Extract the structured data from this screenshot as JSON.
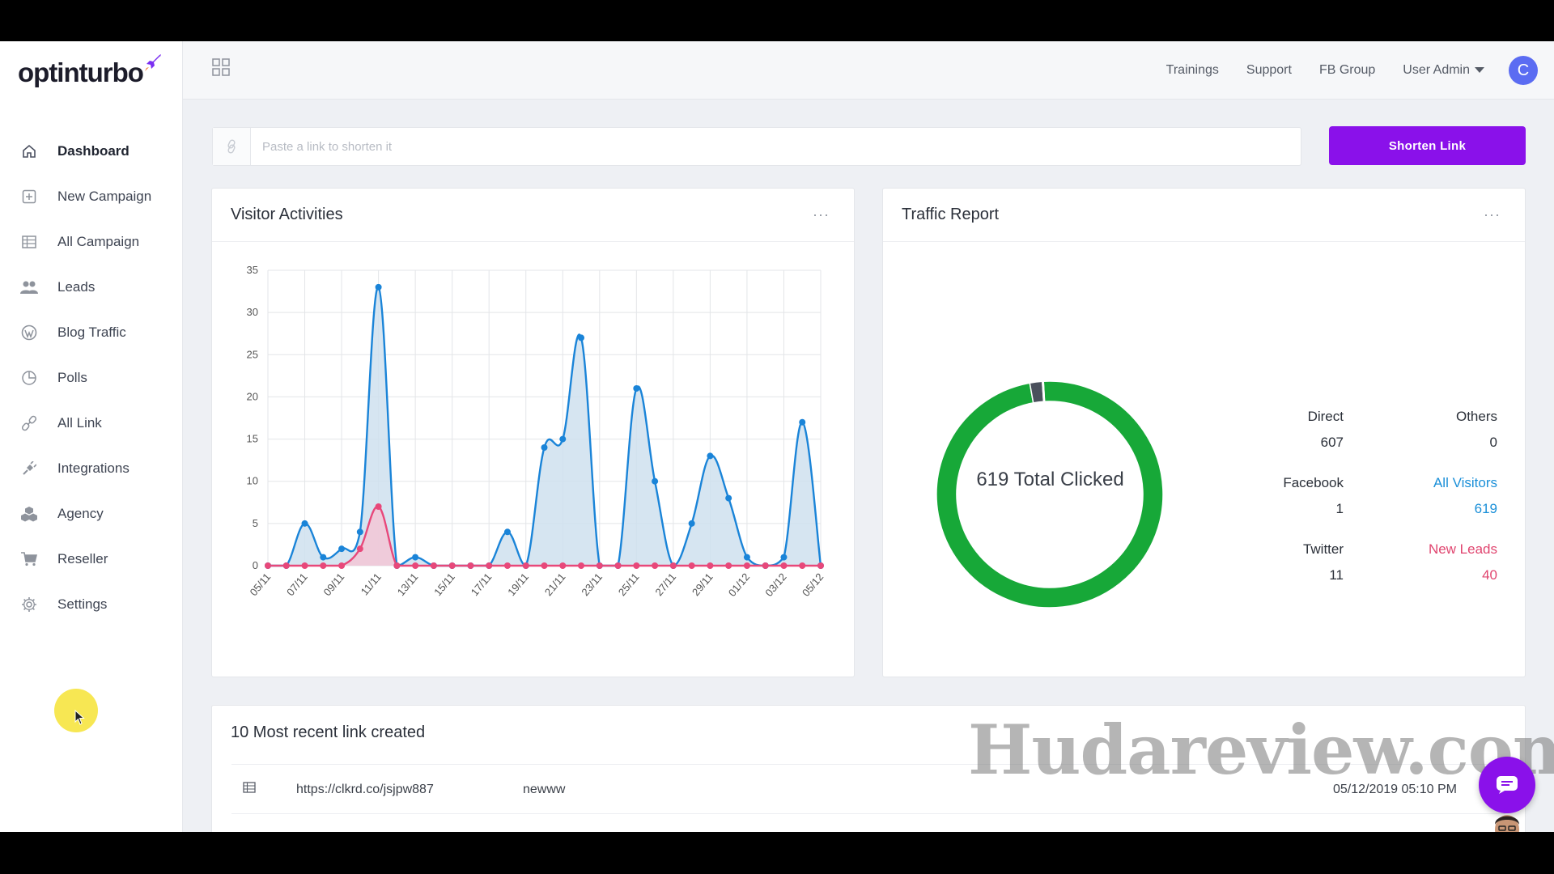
{
  "app": {
    "logo_text": "optinturbo"
  },
  "sidebar": {
    "items": [
      {
        "label": "Dashboard",
        "icon": "home-icon",
        "active": true
      },
      {
        "label": "New Campaign",
        "icon": "plus-square-icon"
      },
      {
        "label": "All Campaign",
        "icon": "table-icon"
      },
      {
        "label": "Leads",
        "icon": "users-icon"
      },
      {
        "label": "Blog Traffic",
        "icon": "wordpress-icon"
      },
      {
        "label": "Polls",
        "icon": "pie-icon"
      },
      {
        "label": "All Link",
        "icon": "link-icon"
      },
      {
        "label": "Integrations",
        "icon": "plug-icon"
      },
      {
        "label": "Agency",
        "icon": "cubes-icon"
      },
      {
        "label": "Reseller",
        "icon": "cart-icon"
      },
      {
        "label": "Settings",
        "icon": "gear-icon"
      }
    ]
  },
  "header": {
    "links": [
      "Trainings",
      "Support",
      "FB Group"
    ],
    "user_menu": "User Admin",
    "avatar_letter": "C"
  },
  "shorten": {
    "placeholder": "Paste a link to shorten it",
    "button_label": "Shorten Link"
  },
  "visitor_card": {
    "title": "Visitor Activities",
    "menu": "···"
  },
  "traffic_card": {
    "title": "Traffic Report",
    "menu": "···",
    "center_label": "619 Total Clicked",
    "stats": {
      "direct_label": "Direct",
      "direct_value": "607",
      "others_label": "Others",
      "others_value": "0",
      "facebook_label": "Facebook",
      "facebook_value": "1",
      "all_visitors_label": "All Visitors",
      "all_visitors_value": "619",
      "twitter_label": "Twitter",
      "twitter_value": "11",
      "new_leads_label": "New Leads",
      "new_leads_value": "40"
    }
  },
  "recent_card": {
    "title": "10 Most recent link created",
    "rows": [
      {
        "url": "https://clkrd.co/jsjpw887",
        "name": "newww",
        "date": "05/12/2019 05:10 PM"
      }
    ]
  },
  "watermark": "Hudareview.com",
  "chart_data": [
    {
      "type": "area",
      "title": "",
      "xlabel": "",
      "ylabel": "",
      "ylim": [
        0,
        35
      ],
      "yticks": [
        0,
        5,
        10,
        15,
        20,
        25,
        30,
        35
      ],
      "grid": true,
      "x": [
        "05/11",
        "06/11",
        "07/11",
        "08/11",
        "09/11",
        "10/11",
        "11/11",
        "12/11",
        "13/11",
        "14/11",
        "15/11",
        "16/11",
        "17/11",
        "18/11",
        "19/11",
        "20/11",
        "21/11",
        "22/11",
        "23/11",
        "24/11",
        "25/11",
        "26/11",
        "27/11",
        "28/11",
        "29/11",
        "30/11",
        "01/12",
        "02/12",
        "03/12",
        "04/12",
        "05/12"
      ],
      "x_tick_labels": [
        "05/11",
        "07/11",
        "09/11",
        "11/11",
        "13/11",
        "15/11",
        "17/11",
        "19/11",
        "21/11",
        "23/11",
        "25/11",
        "27/11",
        "29/11",
        "01/12",
        "03/12",
        "05/12"
      ],
      "series": [
        {
          "name": "",
          "color": "#1a84d8",
          "fill": "#cfe0ee",
          "values": [
            0,
            0,
            5,
            1,
            2,
            4,
            33,
            0,
            1,
            0,
            0,
            0,
            0,
            4,
            0,
            14,
            15,
            27,
            0,
            0,
            21,
            10,
            0,
            5,
            13,
            8,
            1,
            0,
            1,
            17,
            0
          ]
        },
        {
          "name": "",
          "color": "#e8487a",
          "fill": "#f3c7d6",
          "values": [
            0,
            0,
            0,
            0,
            0,
            2,
            7,
            0,
            0,
            0,
            0,
            0,
            0,
            0,
            0,
            0,
            0,
            0,
            0,
            0,
            0,
            0,
            0,
            0,
            0,
            0,
            0,
            0,
            0,
            0,
            0
          ]
        }
      ]
    },
    {
      "type": "pie",
      "title": "",
      "donut": true,
      "categories": [
        "Direct",
        "Twitter",
        "Facebook",
        "Others"
      ],
      "values": [
        607,
        11,
        1,
        0
      ],
      "colors": [
        "#17a838",
        "#4a505c",
        "#3b5998",
        "#aaaaaa"
      ]
    }
  ]
}
